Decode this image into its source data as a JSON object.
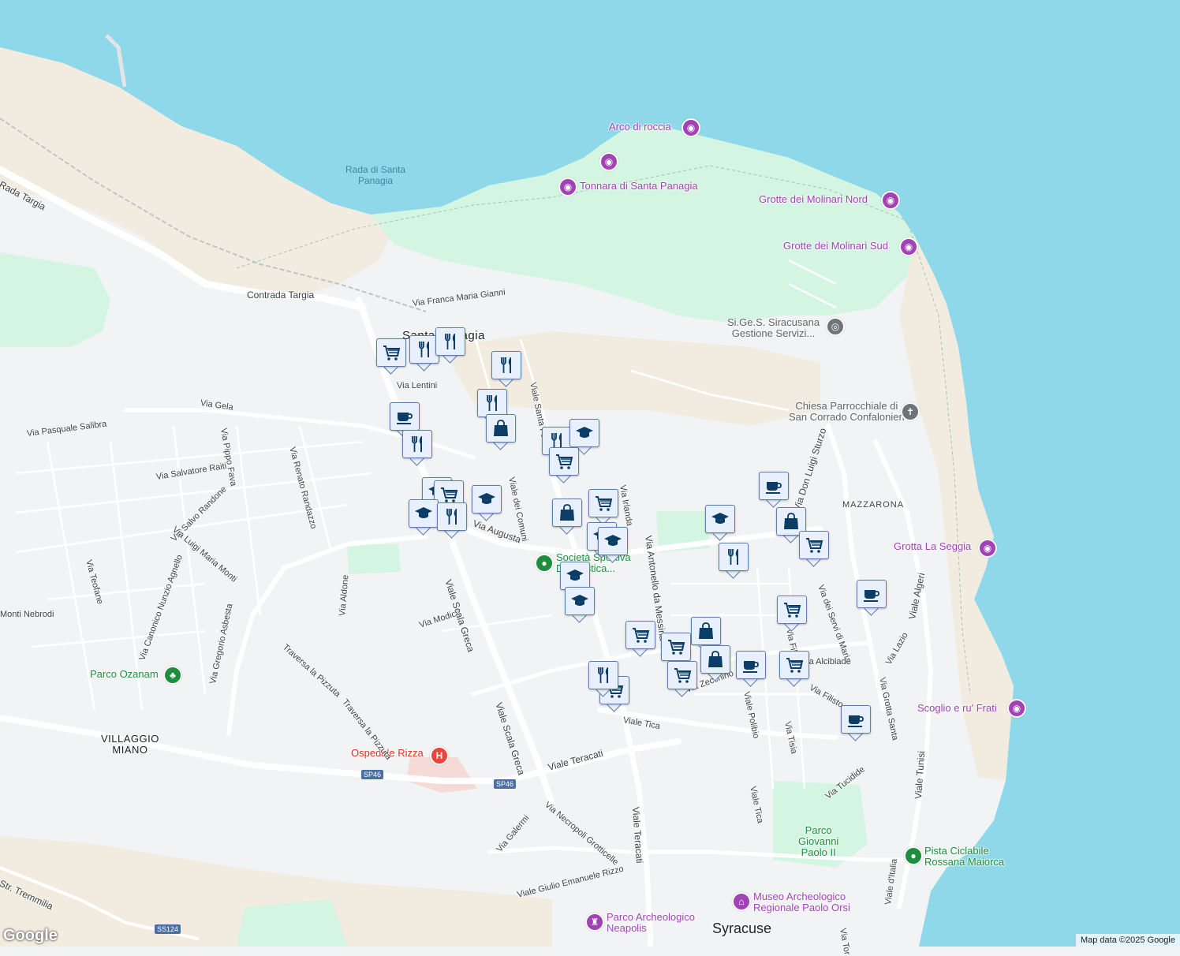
{
  "map": {
    "colors": {
      "water": "#8fd8ea",
      "land": "#f1f3f4",
      "park": "#d4f5e2",
      "sand": "#f2ece0",
      "road": "#ffffff",
      "marker_icon": "#0b3d66"
    },
    "attribution": "Map data ©2025 Google",
    "logo": "Google"
  },
  "labels": {
    "rada": "Rada di Santa\nPanagia",
    "arco": "Arco di roccia",
    "tonnara": "Tonnara di Santa Panagia",
    "grotte_nord": "Grotte dei Molinari Nord",
    "grotte_sud": "Grotte dei Molinari Sud",
    "sigess": "Si.Ge.S. Siracusana\nGestione Servizi...",
    "chiesa": "Chiesa Parrocchiale di\nSan Corrado Confalonieri",
    "mazzarona": "MAZZARONA",
    "grotta_seggia": "Grotta La Seggia",
    "scoglio": "Scoglio e ru' Frati",
    "societa": "Società Sportiva\nD... atistica...",
    "parco_ozanam": "Parco Ozanam",
    "villaggio": "VILLAGGIO\nMIANO",
    "ospedale": "Ospedale Rizza",
    "parco_gp": "Parco\nGiovanni\nPaolo II",
    "pista": "Pista Ciclabile\nRossana Maiorca",
    "museo": "Museo Archeologico\nRegionale Paolo Orsi",
    "parco_arch": "Parco Archeologico\nNeapolis",
    "syracuse": "Syracuse",
    "santa_panagia": "Santa Panagia",
    "contrada_targia": "Contrada Targia",
    "rada_targia": "Rada Targia",
    "via_franca": "Via Franca Maria Gianni",
    "via_lentini": "Via Lentini",
    "via_gela": "Via Gela",
    "via_pasquale": "Via Pasquale Salibra",
    "via_salvatore": "Via Salvatore Raiti",
    "via_pippo": "Via Pippo Fava",
    "via_renato": "Via Renato Randazzo",
    "via_salvo": "Via Salvo Randone",
    "via_luigi": "Via Luigi Maria Monti",
    "via_teofane": "Via Teofane",
    "monti_nebrodi": "Monti Nebrodi",
    "via_canonico": "Via Canonico Nunzio Agnello",
    "via_gregorio": "Via Gregorio Asbesta",
    "via_aldone": "Via Aldone",
    "traversa1": "Traversa la Pizzuta",
    "traversa2": "Traversa la Pizzuta",
    "via_modica": "Via Modica",
    "viale_scala1": "Viale Scala Greca",
    "viale_scala2": "Viale Scala Greca",
    "viale_comuni": "Viale dei Comuni",
    "viale_santa": "Viale Santa Panag",
    "via_augusta": "Via Augusta",
    "via_irlanda": "Via Irlanda",
    "via_antonello": "Via Antonello da Messina",
    "via_don_luigi": "Via Don Luigi Sturzo",
    "via_servi": "Via dei Servi di Maria",
    "via_alcibiade": "Via Alcibiade",
    "via_lazio": "Via Lazio",
    "viale_algeri": "Viale Algeri",
    "via_grotta": "Via Grotta Santa",
    "via_filisto": "Via Filisto",
    "via_tisia": "Via Tisia",
    "viale_polibio": "Viale Polibio",
    "via_zecchino": "Via Zecchino",
    "viale_tica1": "Viale Tica",
    "viale_tica2": "Viale Tica",
    "viale_teracati1": "Viale Teracati",
    "viale_teracati2": "Viale Teracati",
    "via_tucidide": "Via Tucidide",
    "viale_tunisi": "Viale Tunisi",
    "via_necropoli": "Via Necropoli Grotticelle",
    "via_galermi": "Via Galermi",
    "viale_giulio": "Viale Giulio Emanuele Rizzo",
    "str_tremmilia": "Str. Tremmilia",
    "sp46a": "SP46",
    "sp46b": "SP46",
    "ss124": "SS124",
    "via_fili": "Via Fili",
    "viale_italia": "Viale d'Italia",
    "via_tor": "Via Tor"
  },
  "markers": [
    {
      "type": "shopping-cart",
      "icon": "cart"
    },
    {
      "type": "restaurant",
      "icon": "fork"
    },
    {
      "type": "restaurant",
      "icon": "fork"
    },
    {
      "type": "restaurant",
      "icon": "fork"
    },
    {
      "type": "restaurant",
      "icon": "fork"
    },
    {
      "type": "cafe",
      "icon": "cup"
    },
    {
      "type": "restaurant",
      "icon": "fork"
    },
    {
      "type": "shopping-bag",
      "icon": "bag"
    },
    {
      "type": "restaurant",
      "icon": "fork"
    },
    {
      "type": "school",
      "icon": "cap"
    },
    {
      "type": "shopping-cart",
      "icon": "cart"
    },
    {
      "type": "school",
      "icon": "cap"
    },
    {
      "type": "shopping-cart",
      "icon": "cart"
    },
    {
      "type": "school",
      "icon": "cap"
    },
    {
      "type": "school",
      "icon": "cap"
    },
    {
      "type": "restaurant",
      "icon": "fork"
    },
    {
      "type": "shopping-cart",
      "icon": "cart"
    },
    {
      "type": "shopping-bag",
      "icon": "bag"
    },
    {
      "type": "school",
      "icon": "cap"
    },
    {
      "type": "school",
      "icon": "cap"
    },
    {
      "type": "school",
      "icon": "cap"
    },
    {
      "type": "school",
      "icon": "cap"
    },
    {
      "type": "cafe",
      "icon": "cup"
    },
    {
      "type": "school",
      "icon": "cap"
    },
    {
      "type": "shopping-bag",
      "icon": "bag"
    },
    {
      "type": "shopping-cart",
      "icon": "cart"
    },
    {
      "type": "restaurant",
      "icon": "fork"
    },
    {
      "type": "cafe",
      "icon": "cup"
    },
    {
      "type": "shopping-cart",
      "icon": "cart"
    },
    {
      "type": "shopping-cart",
      "icon": "cart"
    },
    {
      "type": "shopping-bag",
      "icon": "bag"
    },
    {
      "type": "shopping-cart",
      "icon": "cart"
    },
    {
      "type": "shopping-bag",
      "icon": "bag"
    },
    {
      "type": "shopping-cart",
      "icon": "cart"
    },
    {
      "type": "cafe",
      "icon": "cup"
    },
    {
      "type": "shopping-cart",
      "icon": "cart"
    },
    {
      "type": "restaurant",
      "icon": "fork"
    },
    {
      "type": "shopping-cart",
      "icon": "cart"
    },
    {
      "type": "cafe",
      "icon": "cup"
    }
  ]
}
